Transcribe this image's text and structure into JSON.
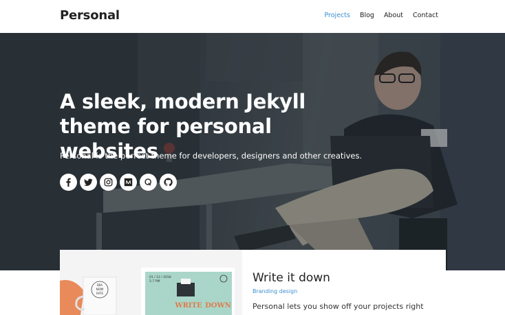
{
  "header": {
    "brand": "Personal",
    "nav": [
      {
        "label": "Projects",
        "active": true
      },
      {
        "label": "Blog",
        "active": false
      },
      {
        "label": "About",
        "active": false
      },
      {
        "label": "Contact",
        "active": false
      }
    ]
  },
  "hero": {
    "title": "A sleek, modern Jekyll theme for personal websites",
    "subtitle": "Personal is the perfect theme for developers, designers and other creatives.",
    "socials": [
      "facebook-icon",
      "twitter-icon",
      "instagram-icon",
      "medium-icon",
      "quora-icon",
      "github-icon"
    ]
  },
  "project": {
    "title": "Write it down",
    "category": "Branding design",
    "description": "Personal lets you show off your projects right",
    "image": {
      "mug_text": "BRA NDIM RATE",
      "poster_date": "01 / 12 / 2018",
      "poster_time": "5-7 PM",
      "poster_title": "WRITE IT DOWN"
    }
  },
  "colors": {
    "accent": "#3a8fd1",
    "hero_overlay": "#3a4249",
    "text": "#222222"
  }
}
